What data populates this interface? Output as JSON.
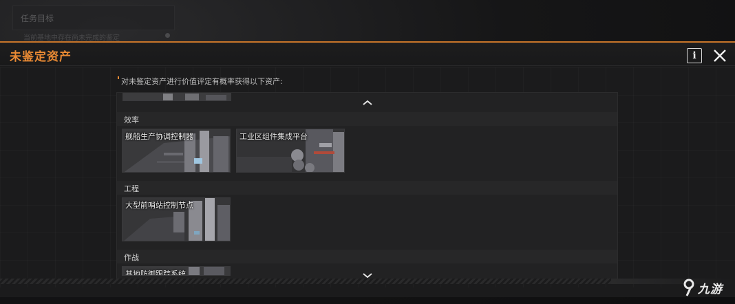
{
  "background": {
    "faint_panel_title": "任务目标",
    "faint_panel_sub": "当前基地中存在尚未完成的鉴定"
  },
  "modal": {
    "title": "未鉴定资产",
    "info_label": "i",
    "accent_color": "#e98a34",
    "hint": "对未鉴定资产进行价值评定有概率获得以下资产:"
  },
  "sections": [
    {
      "label": "效率",
      "items": [
        {
          "name": "舰船生产协调控制器"
        },
        {
          "name": "工业区组件集成平台"
        }
      ]
    },
    {
      "label": "工程",
      "items": [
        {
          "name": "大型前哨站控制节点"
        }
      ]
    },
    {
      "label": "作战",
      "items": [
        {
          "name": "基地防御跟踪系统"
        }
      ]
    }
  ],
  "icons": {
    "close": "close-icon",
    "scroll_up": "chevron-up-icon",
    "scroll_down": "chevron-down-icon",
    "info": "info-icon"
  },
  "watermark": {
    "text": "九游"
  }
}
